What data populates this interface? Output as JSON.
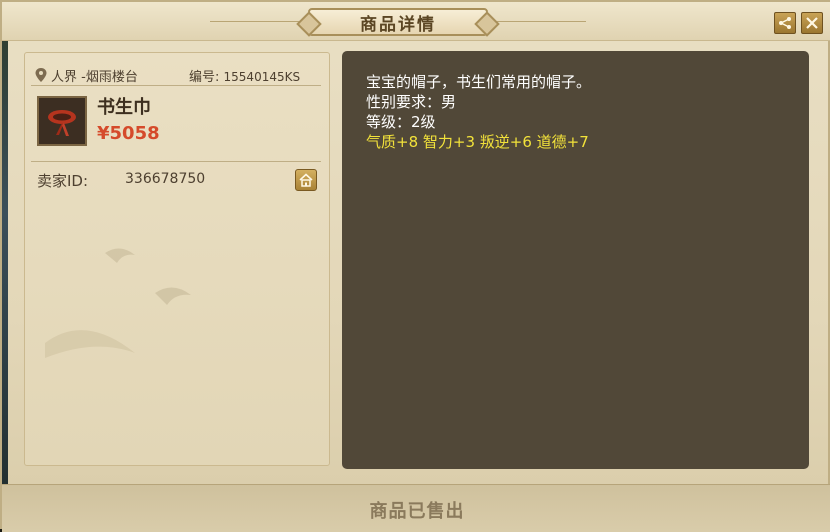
{
  "window": {
    "title": "商品详情"
  },
  "item": {
    "location": "人界 -烟雨楼台",
    "serial_label": "编号:",
    "serial": "15540145KS",
    "name": "书生巾",
    "price": "¥5058",
    "seller_label": "卖家ID:",
    "seller_id": "336678750"
  },
  "description": {
    "line1": "宝宝的帽子，书生们常用的帽子。",
    "line2": "性别要求：男",
    "line3": "等级：2级",
    "attributes": "气质+8 智力+3 叛逆+6 道德+7"
  },
  "footer": {
    "status": "商品已售出"
  },
  "icons": {
    "share": "share-icon",
    "close": "close-icon",
    "location": "location-pin-icon",
    "shop": "shop-home-icon"
  },
  "colors": {
    "price": "#d54a2a",
    "attributes": "#f2e23a",
    "desc_bg": "#514838"
  }
}
